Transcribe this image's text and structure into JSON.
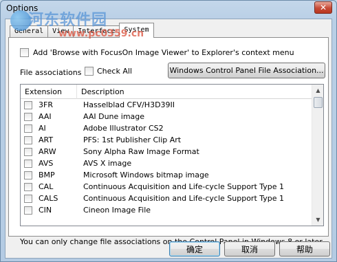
{
  "window": {
    "title": "Options",
    "close_icon": "close-icon"
  },
  "tabs": [
    {
      "label": "General",
      "active": false
    },
    {
      "label": "View",
      "active": false
    },
    {
      "label": "Interface",
      "active": false
    },
    {
      "label": "System",
      "active": true
    }
  ],
  "context_menu_checkbox": {
    "label": "Add 'Browse with FocusOn Image Viewer' to Explorer's context menu",
    "checked": false
  },
  "file_associations": {
    "label": "File associations",
    "check_all_label": "Check All",
    "check_all_checked": false,
    "control_panel_button": "Windows Control Panel File Association..."
  },
  "list": {
    "columns": [
      "Extension",
      "Description"
    ],
    "rows": [
      {
        "ext": "3FR",
        "desc": "Hasselblad CFV/H3D39II",
        "checked": false
      },
      {
        "ext": "AAI",
        "desc": "AAI Dune image",
        "checked": false
      },
      {
        "ext": "AI",
        "desc": "Adobe Illustrator CS2",
        "checked": false
      },
      {
        "ext": "ART",
        "desc": "PFS: 1st Publisher Clip Art",
        "checked": false
      },
      {
        "ext": "ARW",
        "desc": "Sony Alpha Raw Image Format",
        "checked": false
      },
      {
        "ext": "AVS",
        "desc": "AVS X image",
        "checked": false
      },
      {
        "ext": "BMP",
        "desc": "Microsoft Windows bitmap image",
        "checked": false
      },
      {
        "ext": "CAL",
        "desc": "Continuous Acquisition and Life-cycle Support Type 1",
        "checked": false
      },
      {
        "ext": "CALS",
        "desc": "Continuous Acquisition and Life-cycle Support Type 1",
        "checked": false
      },
      {
        "ext": "CIN",
        "desc": "Cineon Image File",
        "checked": false
      }
    ]
  },
  "note": "You can only change file associations on the Control Panel in Windows 8 or later",
  "buttons": {
    "ok": "确定",
    "cancel": "取消",
    "help": "帮助"
  },
  "watermark": {
    "line1": "河东软件园",
    "line2": "www.pc0359.cn"
  }
}
